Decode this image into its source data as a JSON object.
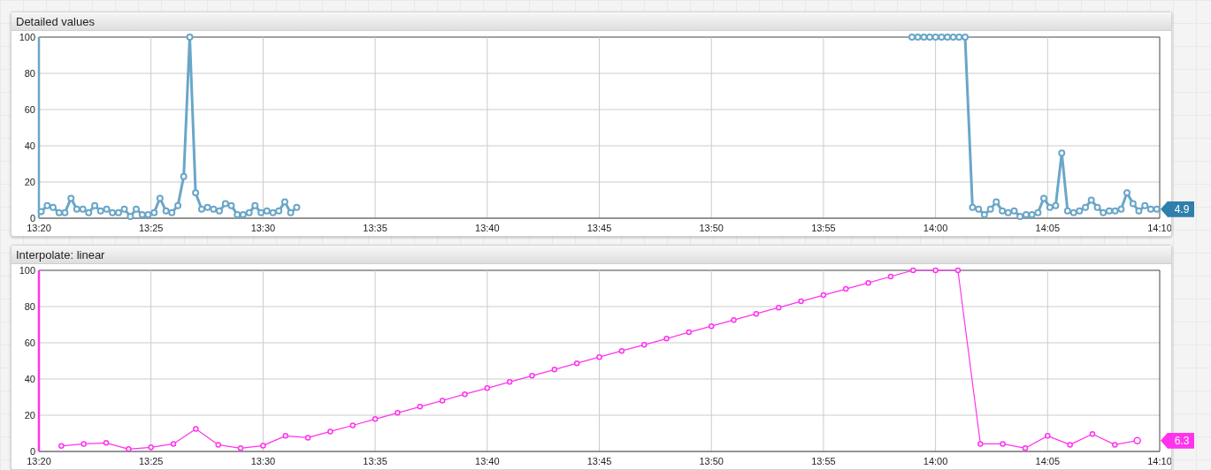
{
  "panels": [
    {
      "title": "Detailed values",
      "value_label": "4.9",
      "chart_data": {
        "type": "line",
        "grid": true,
        "xlim": [
          800,
          850
        ],
        "ylim": [
          0,
          100
        ],
        "yticks": [
          0,
          20,
          40,
          60,
          80,
          100
        ],
        "xticks": [
          {
            "value": 800,
            "label": "13:20"
          },
          {
            "value": 805,
            "label": "13:25"
          },
          {
            "value": 810,
            "label": "13:30"
          },
          {
            "value": 815,
            "label": "13:35"
          },
          {
            "value": 820,
            "label": "13:40"
          },
          {
            "value": 825,
            "label": "13:45"
          },
          {
            "value": 830,
            "label": "13:50"
          },
          {
            "value": 835,
            "label": "13:55"
          },
          {
            "value": 840,
            "label": "14:00"
          },
          {
            "value": 845,
            "label": "14:05"
          },
          {
            "value": 850,
            "label": "14:10"
          }
        ],
        "x": [
          800.1,
          800.37,
          800.63,
          800.9,
          801.16,
          801.43,
          801.69,
          801.96,
          802.22,
          802.49,
          802.75,
          803.02,
          803.28,
          803.55,
          803.81,
          804.08,
          804.34,
          804.61,
          804.87,
          805.14,
          805.4,
          805.67,
          805.93,
          806.2,
          806.46,
          806.73,
          806.99,
          807.26,
          807.52,
          807.79,
          808.05,
          808.32,
          808.58,
          808.85,
          809.11,
          809.38,
          809.64,
          809.91,
          810.17,
          810.44,
          810.7,
          810.97,
          811.23,
          811.5,
          825,
          838.95,
          839.21,
          839.48,
          839.74,
          840.0,
          840.27,
          840.53,
          840.79,
          841.05,
          841.32,
          841.65,
          841.92,
          842.18,
          842.45,
          842.71,
          842.98,
          843.24,
          843.51,
          843.77,
          844.04,
          844.3,
          844.57,
          844.83,
          845.1,
          845.36,
          845.63,
          845.89,
          846.16,
          846.42,
          846.69,
          846.95,
          847.22,
          847.48,
          847.75,
          848.01,
          848.28,
          848.54,
          848.81,
          849.07,
          849.34,
          849.6,
          849.87
        ],
        "series": [
          {
            "color": "#6aa6c8",
            "marker": "circle",
            "values": [
              3.6,
              7,
              6,
              3,
              3,
              11,
              5,
              5,
              3,
              7,
              4,
              5,
              3,
              3,
              5,
              1,
              5,
              2,
              2,
              3,
              11,
              4,
              3,
              7,
              23,
              100,
              14,
              5,
              6,
              5,
              4,
              8,
              7,
              2,
              2,
              3,
              7,
              3,
              4,
              3,
              4,
              9,
              3,
              6,
              null,
              100,
              100,
              100,
              100,
              100,
              100,
              100,
              100,
              100,
              100,
              6,
              5,
              2,
              5,
              9,
              4,
              3,
              4,
              1,
              2,
              2,
              3,
              11,
              6,
              7,
              36,
              4,
              3,
              4,
              6,
              10,
              6,
              3,
              4,
              4,
              5,
              14,
              8,
              4,
              7,
              5,
              5
            ]
          }
        ]
      }
    },
    {
      "title": "Interpolate: linear",
      "value_label": "6.3",
      "chart_data": {
        "type": "line",
        "grid": true,
        "xlim": [
          800,
          850
        ],
        "ylim": [
          0,
          100
        ],
        "yticks": [
          0,
          20,
          40,
          60,
          80,
          100
        ],
        "xticks": [
          {
            "value": 800,
            "label": "13:20"
          },
          {
            "value": 805,
            "label": "13:25"
          },
          {
            "value": 810,
            "label": "13:30"
          },
          {
            "value": 815,
            "label": "13:35"
          },
          {
            "value": 820,
            "label": "13:40"
          },
          {
            "value": 825,
            "label": "13:45"
          },
          {
            "value": 830,
            "label": "13:50"
          },
          {
            "value": 835,
            "label": "13:55"
          },
          {
            "value": 840,
            "label": "14:00"
          },
          {
            "value": 845,
            "label": "14:05"
          },
          {
            "value": 850,
            "label": "14:10"
          }
        ],
        "x": [
          801,
          802,
          803,
          804,
          805,
          806,
          807,
          808,
          809,
          810,
          811,
          812,
          813,
          814,
          815,
          816,
          817,
          818,
          819,
          820,
          821,
          822,
          823,
          824,
          825,
          826,
          827,
          828,
          829,
          830,
          831,
          832,
          833,
          834,
          835,
          836,
          837,
          838,
          839,
          840,
          841,
          842,
          843,
          844,
          845,
          846,
          847,
          848,
          849
        ],
        "series": [
          {
            "color": "#ff33ee",
            "marker": "circle",
            "values": [
              3,
              4.2,
              4.7,
              1.3,
              2.3,
              4.2,
              12.5,
              3.7,
              1.8,
              3.2,
              8.6,
              7.6,
              11,
              14.4,
              17.9,
              21.3,
              24.7,
              28.1,
              31.6,
              35,
              38.4,
              41.8,
              45.2,
              48.7,
              52.1,
              55.5,
              58.9,
              62.3,
              65.8,
              69.2,
              72.6,
              76,
              79.4,
              82.9,
              86.3,
              89.7,
              93.1,
              96.6,
              100,
              100,
              100,
              4.2,
              4.2,
              1.8,
              8.6,
              3.7,
              9.6,
              3.7,
              6
            ]
          }
        ]
      }
    }
  ]
}
